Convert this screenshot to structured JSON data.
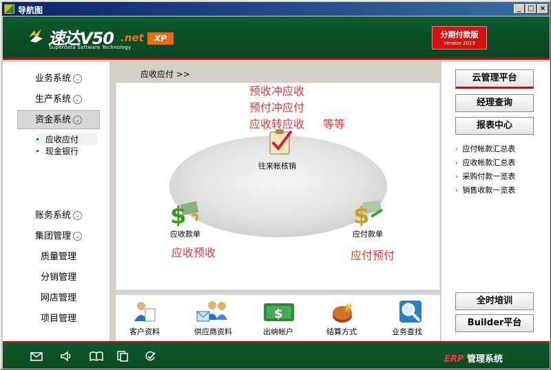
{
  "window": {
    "title": "导航图",
    "min": "_",
    "max": "□",
    "close": "×"
  },
  "header": {
    "logo": "速达V50",
    "logo_net": ".net",
    "logo_sub": "Superdata Software Technology",
    "logo_xp": "XP",
    "edition": "分期付款版",
    "edition_sub": "Version 2015"
  },
  "sidebar": {
    "items": [
      {
        "label": "业务系统",
        "chevron": "⌄"
      },
      {
        "label": "生产系统",
        "chevron": "⌄"
      },
      {
        "label": "资金系统",
        "chevron": "⌄"
      }
    ],
    "subitems": [
      "应收应付",
      "现金银行"
    ],
    "lower": [
      {
        "label": "账务系统",
        "chevron": "⌄"
      },
      {
        "label": "集团管理",
        "chevron": "⌄"
      }
    ],
    "plain": [
      "质量管理",
      "分销管理",
      "网店管理",
      "项目管理"
    ]
  },
  "breadcrumb": {
    "text": "应收应付",
    "sep": ">>"
  },
  "diagram": {
    "annotations": [
      "预收冲应收",
      "预付冲应付",
      "应收转应收",
      "等等"
    ],
    "center": "往来帐核销",
    "left": "应收款单",
    "right": "应付款单",
    "left_note": "应收预收",
    "right_note": "应付预付"
  },
  "bottom": [
    "客户资料",
    "供应商资料",
    "出纳帐户",
    "结算方式",
    "业务查找"
  ],
  "right": {
    "buttons": [
      "云管理平台",
      "经理查询",
      "报表中心"
    ],
    "links": [
      "应付帐款汇总表",
      "应收帐款汇总表",
      "采购付款一览表",
      "销售收款一览表"
    ],
    "lower_buttons": [
      "全时培训",
      "Builder平台"
    ]
  },
  "footer": {
    "erp": "ERP",
    "brand": "管理系统"
  },
  "colors": {
    "header_green": "#0a4d25",
    "accent_red": "#c01010",
    "annotation_red": "#e83838"
  }
}
